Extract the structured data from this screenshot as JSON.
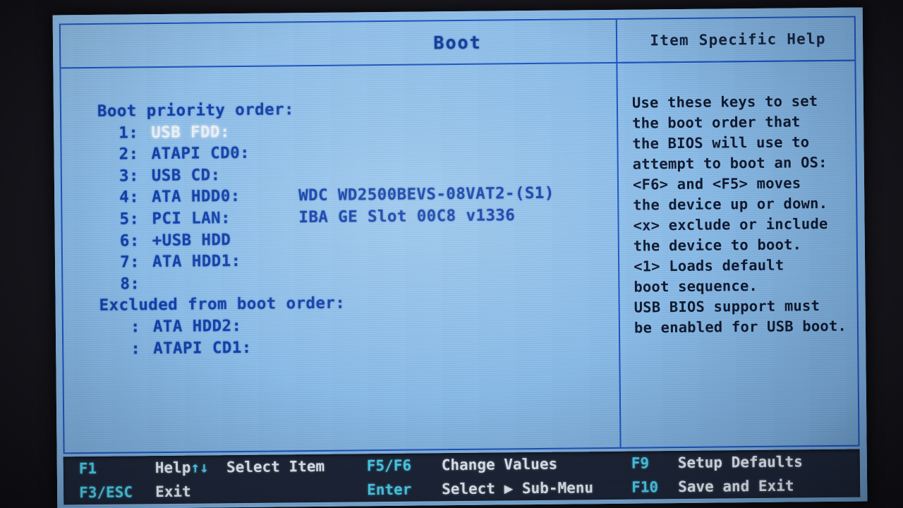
{
  "screen": {
    "page_title": "Boot",
    "bg_color": "#8ec0ec",
    "text_color": "#1342ad",
    "rule_color": "#1f55c4",
    "selected_text_color": "#eef4fb"
  },
  "boot": {
    "priority_heading": "Boot priority order:",
    "excluded_heading": "Excluded from boot order:",
    "items": [
      {
        "index": "1:",
        "device": "USB FDD:",
        "detail": "",
        "selected": true
      },
      {
        "index": "2:",
        "device": "ATAPI CD0:",
        "detail": "",
        "selected": false
      },
      {
        "index": "3:",
        "device": "USB CD:",
        "detail": "",
        "selected": false
      },
      {
        "index": "4:",
        "device": "ATA HDD0:",
        "detail": "WDC WD2500BEVS-08VAT2-(S1)",
        "selected": false
      },
      {
        "index": "5:",
        "device": "PCI LAN:",
        "detail": "IBA GE Slot 00C8 v1336",
        "selected": false
      },
      {
        "index": "6:",
        "device": "+USB HDD",
        "detail": "",
        "selected": false
      },
      {
        "index": "7:",
        "device": "ATA HDD1:",
        "detail": "",
        "selected": false
      },
      {
        "index": "8:",
        "device": "",
        "detail": "",
        "selected": false
      }
    ],
    "excluded_items": [
      {
        "index": ":",
        "device": "ATA HDD2:",
        "detail": ""
      },
      {
        "index": ":",
        "device": "ATAPI CD1:",
        "detail": ""
      }
    ]
  },
  "help": {
    "title": "Item Specific Help",
    "lines": [
      "Use these keys to set",
      "the boot order that",
      "the BIOS will use to",
      "attempt to boot an OS:",
      "<F6> and <F5> moves",
      "the device up or down.",
      "<x> exclude or include",
      "the device to boot.",
      "<1> Loads default",
      "boot sequence.",
      "USB BIOS support must",
      "be enabled for USB boot."
    ]
  },
  "legend": {
    "key_color": "#4fd4f2",
    "label_color": "#e8f1fa",
    "bg_color": "#1d2639",
    "rows": [
      {
        "key": "F1",
        "label": "Help",
        "arrows": "↑↓"
      },
      {
        "key": "F3/ESC",
        "label": "Exit",
        "arrows": ""
      }
    ],
    "nav": [
      {
        "key": "",
        "label": "Select Item"
      },
      {
        "key": "",
        "label": ""
      }
    ],
    "middle": [
      {
        "key": "F5/F6",
        "label": "Change Values"
      },
      {
        "key": "Enter",
        "label": "Select ▶ Sub-Menu"
      }
    ],
    "right": [
      {
        "key": "F9",
        "label": "Setup Defaults"
      },
      {
        "key": "F10",
        "label": "Save and Exit"
      }
    ],
    "select_item_label": "Select Item",
    "select_submenu_prefix": "Select ",
    "select_submenu_arrow": "▶",
    "select_submenu_suffix": " Sub-Menu"
  }
}
